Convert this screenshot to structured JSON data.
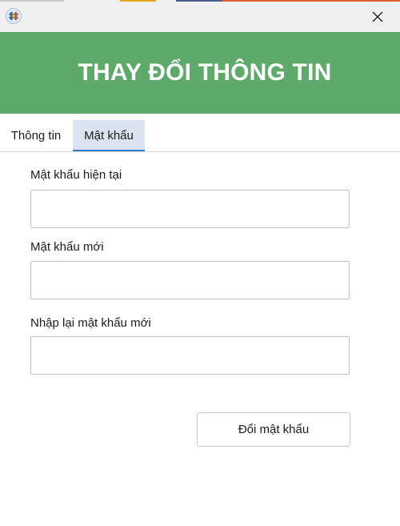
{
  "window": {
    "app_icon": "app-logo-icon",
    "close_icon": "close-icon",
    "titlebar_bg": "#f0f0f0"
  },
  "banner": {
    "title": "THAY ĐỔI THÔNG TIN",
    "bg_color": "#5daa6a",
    "text_color": "#ffffff"
  },
  "tabs": [
    {
      "label": "Thông tin",
      "active": false
    },
    {
      "label": "Mật khẩu",
      "active": true
    }
  ],
  "tab_style": {
    "active_bg": "#d9e4f0",
    "active_indicator": "#2f80c6"
  },
  "form": {
    "current_password": {
      "label": "Mật khẩu hiện tại",
      "value": ""
    },
    "new_password": {
      "label": "Mật khẩu mới",
      "value": ""
    },
    "confirm_password": {
      "label": "Nhập lại mật khẩu mới",
      "value": ""
    },
    "submit_label": "Đổi mật khẩu"
  }
}
